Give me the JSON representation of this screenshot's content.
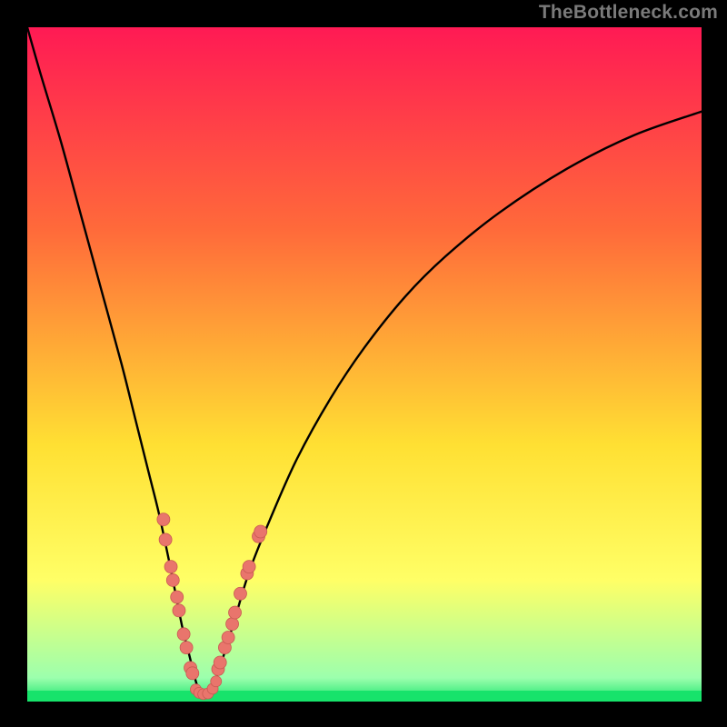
{
  "watermark": "TheBottleneck.com",
  "colors": {
    "frame_bg": "#000000",
    "curve": "#000000",
    "dot_fill": "#e9756c",
    "dot_stroke": "#c85a52",
    "gradient_top": "#ff1a54",
    "gradient_mid1": "#ff6a3a",
    "gradient_mid2": "#ffe033",
    "gradient_bottom_yellow": "#ffff66",
    "gradient_green_light": "#9cffad",
    "gradient_green": "#17e36b"
  },
  "chart_data": {
    "type": "line",
    "title": "",
    "xlabel": "",
    "ylabel": "",
    "xlim": [
      0,
      100
    ],
    "ylim": [
      0,
      100
    ],
    "x": [
      0,
      2,
      5,
      8,
      11,
      14,
      16,
      18,
      19.5,
      21,
      22,
      23,
      24,
      25,
      25.7,
      26.3,
      27,
      28,
      29.5,
      31,
      33,
      36,
      40,
      45,
      50,
      56,
      62,
      70,
      80,
      90,
      100
    ],
    "y": [
      100,
      93,
      83,
      72,
      61,
      50,
      42,
      34,
      28,
      21,
      16,
      11,
      7,
      3,
      1,
      0.5,
      1.2,
      3.5,
      8,
      13,
      19.5,
      27,
      36,
      45,
      52.5,
      60,
      66,
      72.5,
      79,
      84,
      87.5
    ],
    "series": [
      {
        "name": "bottleneck-curve",
        "x_ref": "x",
        "y_ref": "y"
      }
    ],
    "dots_left": [
      {
        "x": 20.2,
        "y": 27
      },
      {
        "x": 20.5,
        "y": 24
      },
      {
        "x": 21.3,
        "y": 20
      },
      {
        "x": 21.6,
        "y": 18
      },
      {
        "x": 22.2,
        "y": 15.5
      },
      {
        "x": 22.5,
        "y": 13.5
      },
      {
        "x": 23.2,
        "y": 10
      },
      {
        "x": 23.6,
        "y": 8
      },
      {
        "x": 24.2,
        "y": 5
      },
      {
        "x": 24.5,
        "y": 4.2
      }
    ],
    "dots_right": [
      {
        "x": 28.3,
        "y": 4.8
      },
      {
        "x": 28.6,
        "y": 5.8
      },
      {
        "x": 29.3,
        "y": 8
      },
      {
        "x": 29.8,
        "y": 9.5
      },
      {
        "x": 30.4,
        "y": 11.5
      },
      {
        "x": 30.8,
        "y": 13.2
      },
      {
        "x": 31.6,
        "y": 16
      },
      {
        "x": 32.6,
        "y": 19
      },
      {
        "x": 32.9,
        "y": 20
      },
      {
        "x": 34.3,
        "y": 24.5
      },
      {
        "x": 34.6,
        "y": 25.2
      }
    ],
    "dots_bottom": [
      {
        "x": 25.0,
        "y": 1.8
      },
      {
        "x": 25.5,
        "y": 1.3
      },
      {
        "x": 26.1,
        "y": 1.1
      },
      {
        "x": 26.8,
        "y": 1.2
      },
      {
        "x": 27.5,
        "y": 1.9
      },
      {
        "x": 28.0,
        "y": 3.0
      }
    ]
  }
}
